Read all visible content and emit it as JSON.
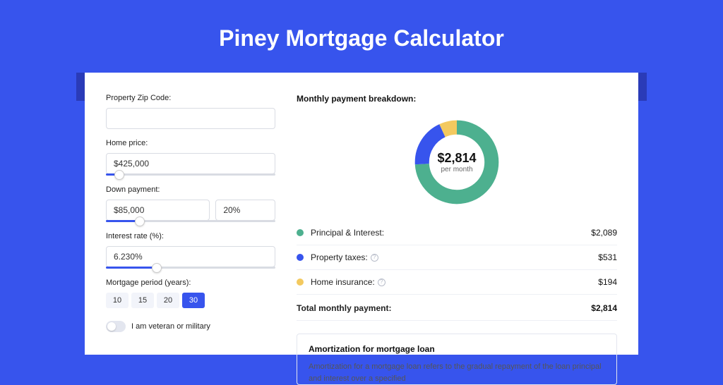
{
  "title": "Piney Mortgage Calculator",
  "form": {
    "zip": {
      "label": "Property Zip Code:",
      "value": ""
    },
    "home_price": {
      "label": "Home price:",
      "value": "$425,000",
      "slider_pct": 8
    },
    "down_payment": {
      "label": "Down payment:",
      "amount": "$85,000",
      "percent": "20%",
      "slider_pct": 20
    },
    "interest_rate": {
      "label": "Interest rate (%):",
      "value": "6.230%",
      "slider_pct": 30
    },
    "period": {
      "label": "Mortgage period (years):",
      "options": [
        "10",
        "15",
        "20",
        "30"
      ],
      "selected": "30"
    },
    "veteran": {
      "label": "I am veteran or military",
      "on": false
    }
  },
  "breakdown": {
    "title": "Monthly payment breakdown:",
    "center_amount": "$2,814",
    "center_sub": "per month",
    "items": [
      {
        "key": "principal",
        "label": "Principal & Interest:",
        "value": "$2,089",
        "color": "green",
        "pct": 74
      },
      {
        "key": "taxes",
        "label": "Property taxes:",
        "value": "$531",
        "color": "blue",
        "pct": 19,
        "info": true
      },
      {
        "key": "insurance",
        "label": "Home insurance:",
        "value": "$194",
        "color": "yellow",
        "pct": 7,
        "info": true
      }
    ],
    "total": {
      "label": "Total monthly payment:",
      "value": "$2,814"
    }
  },
  "amortization": {
    "title": "Amortization for mortgage loan",
    "text": "Amortization for a mortgage loan refers to the gradual repayment of the loan principal and interest over a specified"
  },
  "chart_data": {
    "type": "pie",
    "title": "Monthly payment breakdown",
    "series": [
      {
        "name": "Principal & Interest",
        "value": 2089
      },
      {
        "name": "Property taxes",
        "value": 531
      },
      {
        "name": "Home insurance",
        "value": 194
      }
    ],
    "total": 2814,
    "unit": "USD per month"
  }
}
